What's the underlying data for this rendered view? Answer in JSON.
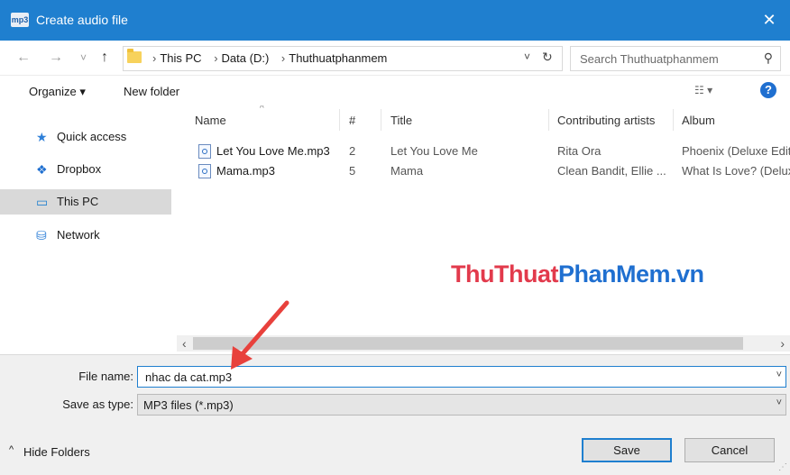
{
  "window": {
    "title": "Create audio file",
    "app_icon_text": "mp3",
    "close_glyph": "✕"
  },
  "nav_buttons": {
    "back": "←",
    "forward": "→",
    "recent": "˅",
    "up": "↑"
  },
  "address": {
    "crumbs": [
      "This PC",
      "Data (D:)",
      "Thuthuatphanmem"
    ],
    "separator": "›",
    "dropdown": "˅",
    "refresh": "↻"
  },
  "search": {
    "placeholder": "Search Thuthuatphanmem",
    "icon": "search-icon",
    "glyph": "⚲"
  },
  "toolbar": {
    "organize": "Organize ▾",
    "new_folder": "New folder",
    "view_glyph": "☷ ▾",
    "help_glyph": "?"
  },
  "nav_pane": {
    "items": [
      {
        "label": "Quick access",
        "icon": "star-icon",
        "glyph": "★",
        "color": "#2d7fd8"
      },
      {
        "label": "Dropbox",
        "icon": "dropbox-icon",
        "glyph": "❖",
        "color": "#1f6fd0"
      },
      {
        "label": "This PC",
        "icon": "computer-icon",
        "glyph": "▭",
        "color": "#1f7fcf"
      },
      {
        "label": "Network",
        "icon": "network-icon",
        "glyph": "⛁",
        "color": "#2d7fd8"
      }
    ]
  },
  "columns": [
    "Name",
    "#",
    "Title",
    "Contributing artists",
    "Album"
  ],
  "sort_glyph": "^",
  "files": [
    {
      "name": "Let You Love Me.mp3",
      "track": "2",
      "title": "Let You Love Me",
      "artists": "Rita Ora",
      "album": "Phoenix (Deluxe Edit"
    },
    {
      "name": "Mama.mp3",
      "track": "5",
      "title": "Mama",
      "artists": "Clean Bandit, Ellie ...",
      "album": "What Is Love? (Delux"
    }
  ],
  "scroll": {
    "left": "‹",
    "right": "›"
  },
  "watermark": {
    "part1": "ThuThuat",
    "part2": "PhanMem.vn"
  },
  "form": {
    "file_name_label": "File name:",
    "file_name_value": "nhac da cat.mp3",
    "save_type_label": "Save as type:",
    "save_type_value": "MP3 files (*.mp3)",
    "caret": "˅"
  },
  "footer": {
    "hide_folders": "Hide Folders",
    "hide_caret": "^",
    "save": "Save",
    "cancel": "Cancel",
    "grip": "⋰"
  },
  "colors": {
    "accent": "#1f7fcf",
    "annotation_arrow": "#e8413c"
  }
}
